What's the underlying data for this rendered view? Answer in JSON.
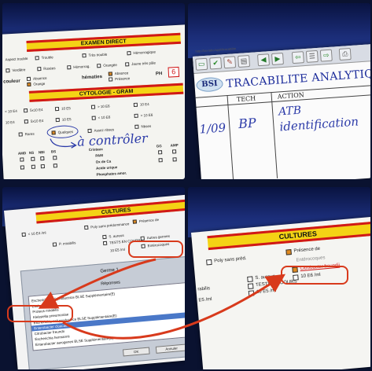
{
  "tile_a": {
    "header": "EXAMEN DIRECT",
    "row1": [
      "Aspect trouble",
      "Trouble",
      "Très trouble",
      "Hémorragique"
    ],
    "row2": [
      "Verdâtre",
      "Rosées",
      "Hémorrag.",
      "Orangée",
      "Jaune très pâle"
    ],
    "couleur_label": "couleur",
    "couleur_opts": [
      "Absence",
      "Orange"
    ],
    "hematies_label": "hématies",
    "hematies_opts": [
      "Absence",
      "Présence"
    ],
    "ph_label": "PH",
    "ph_value": "6",
    "cytology_header": "CYTOLOGIE - GRAM",
    "grid_vals": [
      "< 10 E4",
      "5x10 E4",
      "10 E5",
      "> 10 E6",
      "10 E4",
      "5x10 E4",
      "10 E5",
      "< 10 E6",
      "> 10 E6"
    ],
    "rare_label": "Rares",
    "quelques_label": "Quelques",
    "assez_label": "Assez nbses",
    "nbreux_label": "Nbses",
    "handwritten": "à contrôler",
    "list_items": [
      "Cristaux",
      "PAM",
      "Ox de Ca",
      "Acide urique",
      "Phosphates amor."
    ],
    "col_labels": [
      "AMD",
      "NS",
      "NBI",
      "BS",
      "GG",
      "AMP"
    ]
  },
  "tile_b": {
    "address": "http://bsi-labo/appli/tracabilite",
    "logo": "BSI",
    "title": "TRACABILITE ANALYTIQUE",
    "col_tech": "TECH",
    "col_action": "ACTION",
    "hand_date": "1/09",
    "hand_tech": "BP",
    "hand_action_1": "ATB",
    "hand_action_2": "identification",
    "toolbar_labels": [
      "Nouveau",
      "Valider",
      "Modifier",
      "Supprimer"
    ]
  },
  "tile_c": {
    "header": "CULTURES",
    "items": [
      "< 10 E4 /ml",
      "Poly sans prédominance",
      "Présence de",
      "P. mirabilis",
      "S. aureus",
      "TESTS EN COURS",
      "Autres germes",
      "Entérocoques",
      "10 E5 /ml"
    ],
    "dialog_title": "Germe 1",
    "dialog_subtitle": "Réponses",
    "list": [
      "Escherichia coli productrice BLSE Supplémentaire(E)",
      "Escherichia coli",
      "Proteus mirabilis",
      "Klebsiella pneumoniae",
      "Escherichia coli productrice BLSE Supplémentaire(E)",
      "Enterobacter cloacae",
      "Citrobacter freundii",
      "Escherichia hermannii",
      "Enterobacter aerogenes BLSE Supplémentaire(E)"
    ],
    "selected_index": 5,
    "buttons": [
      "OK",
      "Annuler"
    ]
  },
  "tile_d": {
    "header": "CULTURES",
    "poly_label": "Poly sans préd.",
    "presence_label": "Présence de",
    "side_labels": [
      "rabilis",
      "E5 /ml"
    ],
    "s_aureus": "S. aureus",
    "tests": "TESTS EN COURS",
    "e5": "10 E5 /ml",
    "citrobacter": "Citrobacter freundii",
    "e6": "10 E6 /ml",
    "partial": "Entérocoques"
  },
  "colors": {
    "accent_red": "#d83a1c",
    "banner_yellow": "#f4d315",
    "banner_border": "#d01818",
    "band_blue": "#1b2d78",
    "handwriting": "#2b3aa8"
  }
}
